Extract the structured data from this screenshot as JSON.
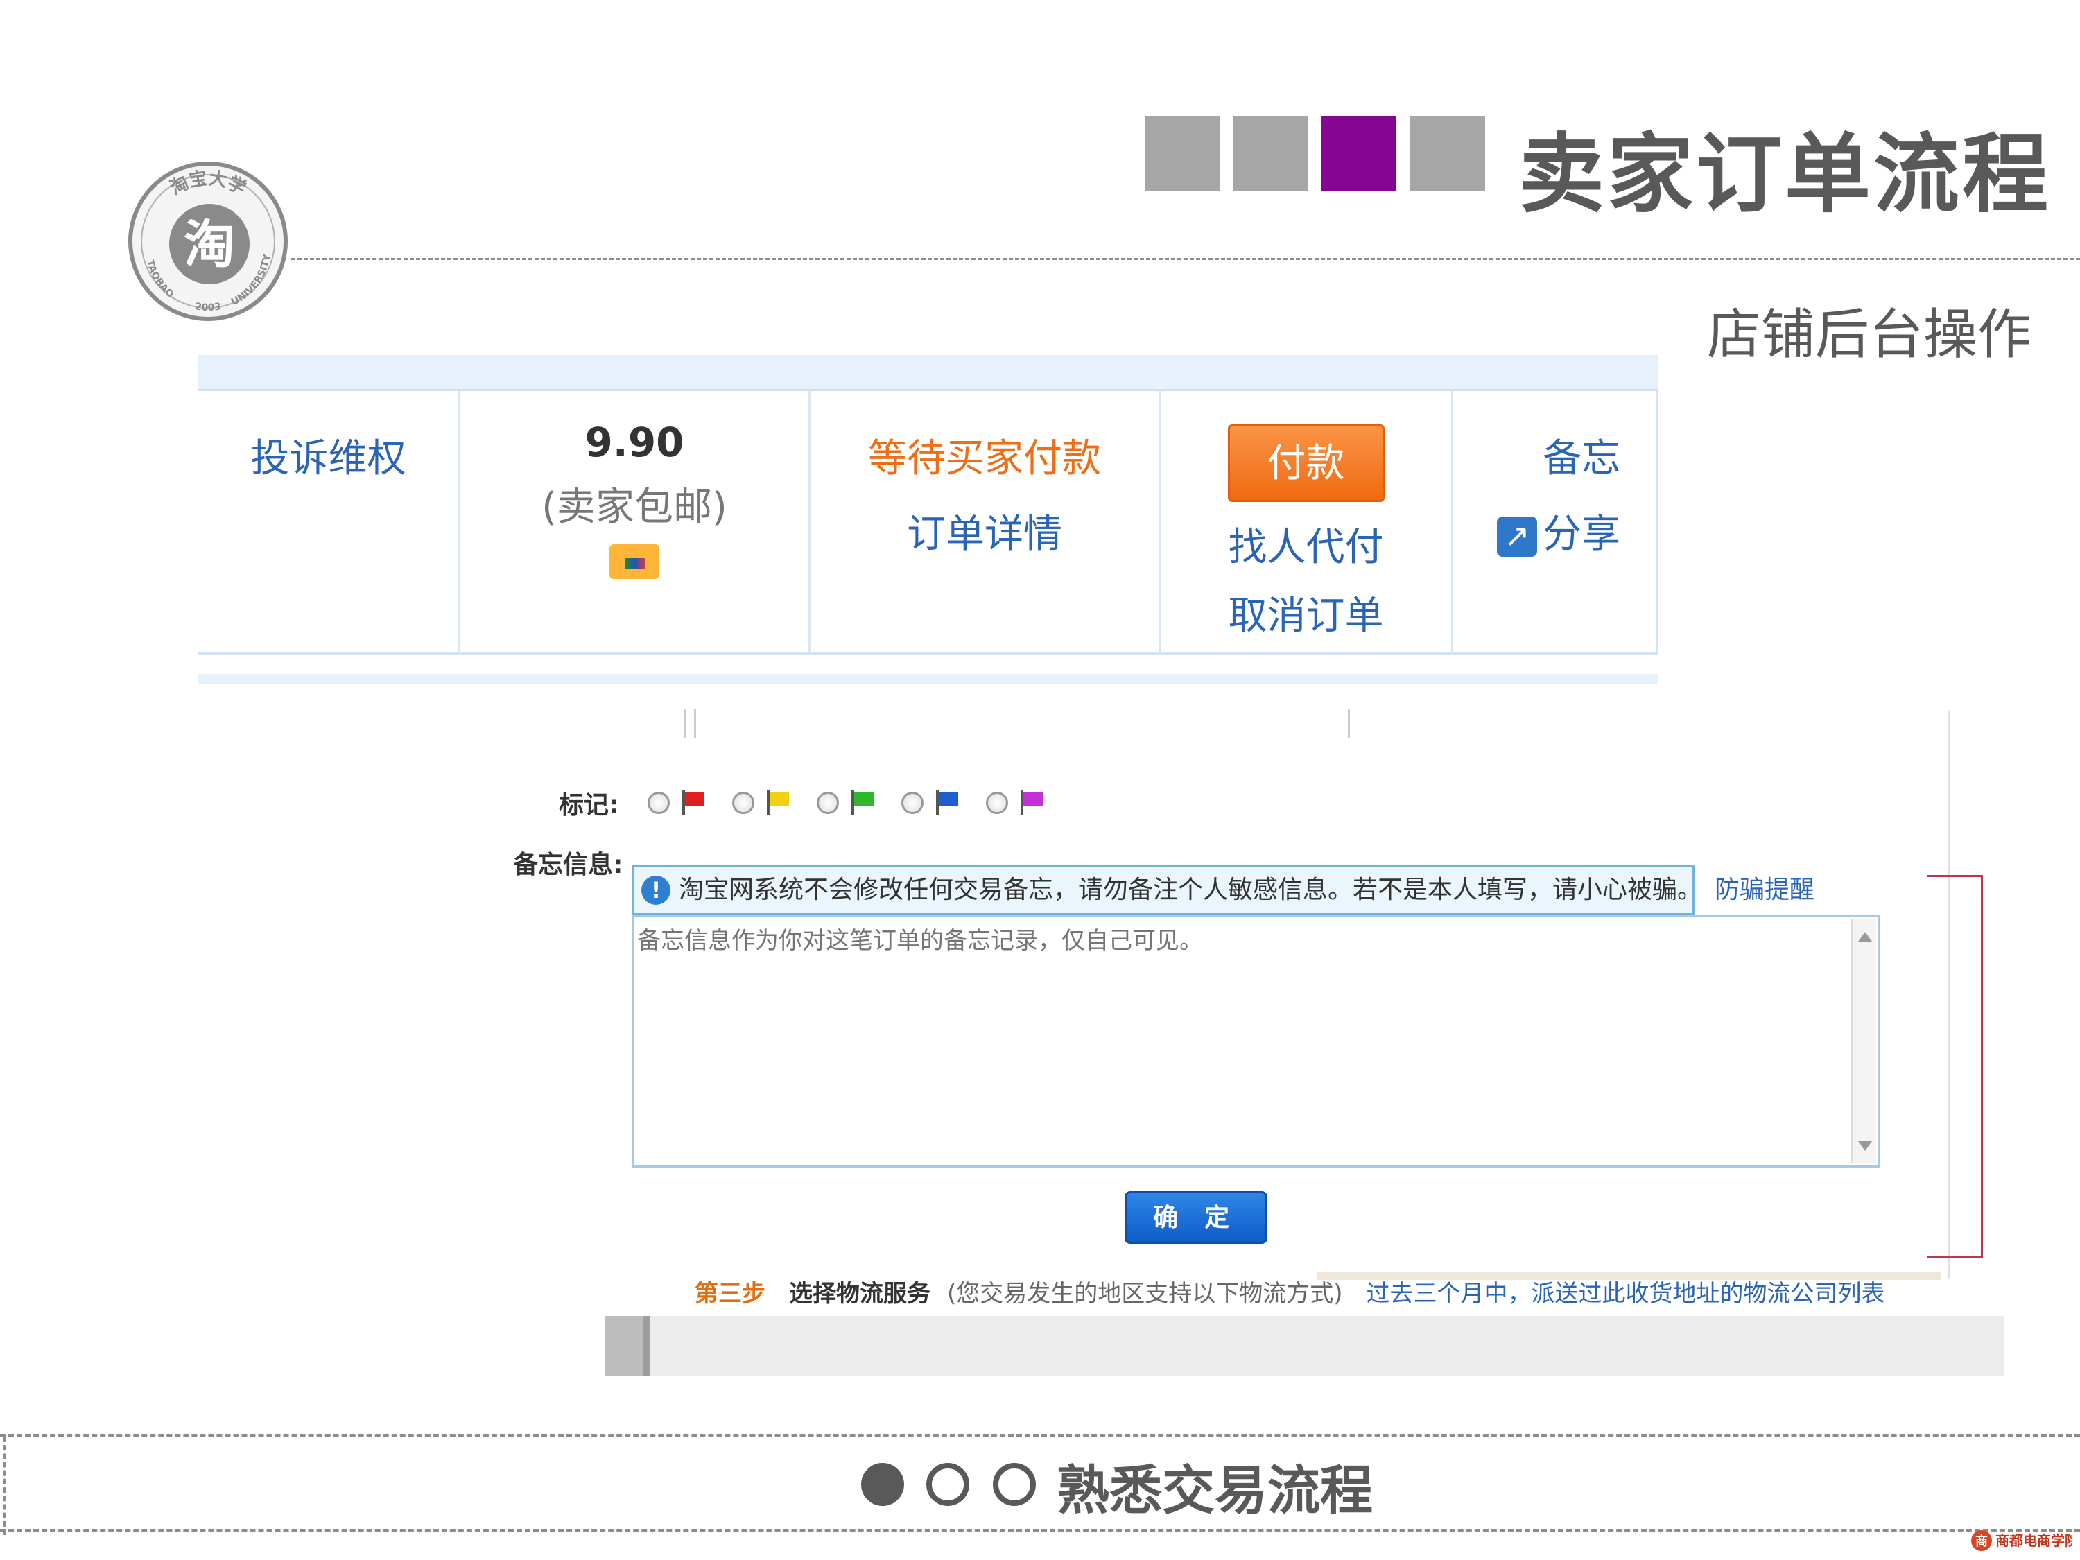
{
  "header": {
    "title": "卖家订单流程",
    "subtitle": "店铺后台操作",
    "colors": {
      "square": "#a6a6a6",
      "active_square": "#850590"
    }
  },
  "order_row": {
    "complaint_link": "投诉维权",
    "price": "9.90",
    "shipping_note": "(卖家包邮)",
    "status": "等待买家付款",
    "order_detail_link": "订单详情",
    "pay_button": "付款",
    "proxy_pay_link": "找人代付",
    "cancel_order_link": "取消订单",
    "memo_link": "备忘",
    "share_link": "分享"
  },
  "memo_dialog": {
    "mark_label": "标记:",
    "memo_label": "备忘信息:",
    "flags": [
      {
        "name": "red",
        "color": "#e02020"
      },
      {
        "name": "yellow",
        "color": "#f2d20c"
      },
      {
        "name": "green",
        "color": "#2fb82f"
      },
      {
        "name": "blue",
        "color": "#1d5fd0"
      },
      {
        "name": "purple",
        "color": "#c42fd8"
      }
    ],
    "notice_text": "淘宝网系统不会修改任何交易备忘，请勿备注个人敏感信息。若不是本人填写，请小心被骗。",
    "notice_link": "防骗提醒",
    "memo_placeholder": "备忘信息作为你对这笔订单的备忘记录，仅自己可见。",
    "ok_button": "确 定"
  },
  "step": {
    "step_label": "第三步",
    "title": "选择物流服务",
    "note": "(您交易发生的地区支持以下物流方式)",
    "link": "过去三个月中，派送过此收货地址的物流公司列表"
  },
  "footer": {
    "title": "熟悉交易流程"
  },
  "logo": {
    "seal_text_top": "淘宝大学",
    "seal_center": "淘",
    "seal_text_left": "TAOBAO",
    "seal_text_right": "UNIVERSITY",
    "seal_year": "2003",
    "brand_text": "商都电商学院"
  }
}
